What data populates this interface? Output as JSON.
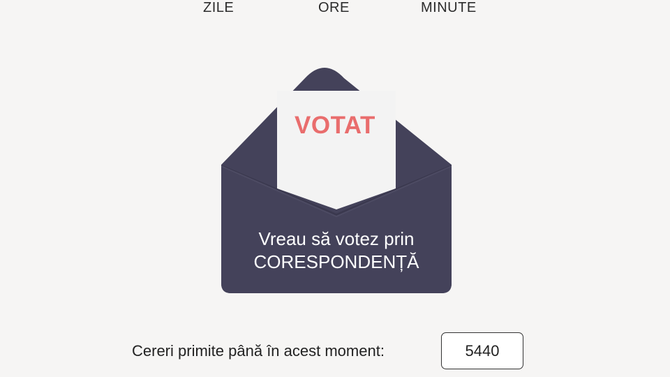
{
  "countdown": {
    "labels": {
      "days": "ZILE",
      "hours": "ORE",
      "minutes": "MINUTE"
    }
  },
  "envelope": {
    "stamp_text": "VOTAT",
    "cta_line1": "Vreau să votez prin",
    "cta_line2": "CORESPONDENȚĂ",
    "colors": {
      "envelope": "#44425a",
      "paper": "#f3f3f3",
      "stamp": "#e96d6d"
    }
  },
  "requests": {
    "label": "Cereri primite până în acest moment:",
    "value": "5440"
  }
}
